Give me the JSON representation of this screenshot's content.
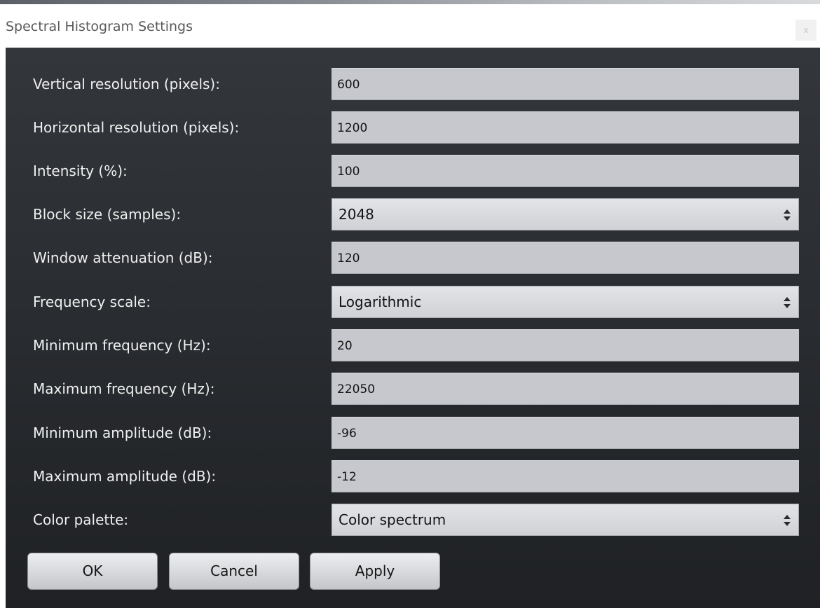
{
  "dialog": {
    "title": "Spectral Histogram Settings",
    "close_label": "x"
  },
  "settings": {
    "vertical_resolution": {
      "label": "Vertical resolution (pixels):",
      "value": "600"
    },
    "horizontal_resolution": {
      "label": "Horizontal resolution (pixels):",
      "value": "1200"
    },
    "intensity": {
      "label": "Intensity (%):",
      "value": "100"
    },
    "block_size": {
      "label": "Block size (samples):",
      "value": "2048"
    },
    "window_attenuation": {
      "label": "Window attenuation (dB):",
      "value": "120"
    },
    "frequency_scale": {
      "label": "Frequency scale:",
      "value": "Logarithmic"
    },
    "minimum_frequency": {
      "label": "Minimum frequency (Hz):",
      "value": "20"
    },
    "maximum_frequency": {
      "label": "Maximum frequency (Hz):",
      "value": "22050"
    },
    "minimum_amplitude": {
      "label": "Minimum amplitude (dB):",
      "value": "-96"
    },
    "maximum_amplitude": {
      "label": "Maximum amplitude (dB):",
      "value": "-12"
    },
    "color_palette": {
      "label": "Color palette:",
      "value": "Color spectrum"
    }
  },
  "buttons": {
    "ok": "OK",
    "cancel": "Cancel",
    "apply": "Apply"
  },
  "icons": {
    "dropdown": "up-down-arrows-icon",
    "close": "close-icon"
  },
  "colors": {
    "background_top": "#33363b",
    "background_bottom": "#1f2124",
    "label_text": "#f0f0f0",
    "field_background": "#c6c8cd"
  }
}
